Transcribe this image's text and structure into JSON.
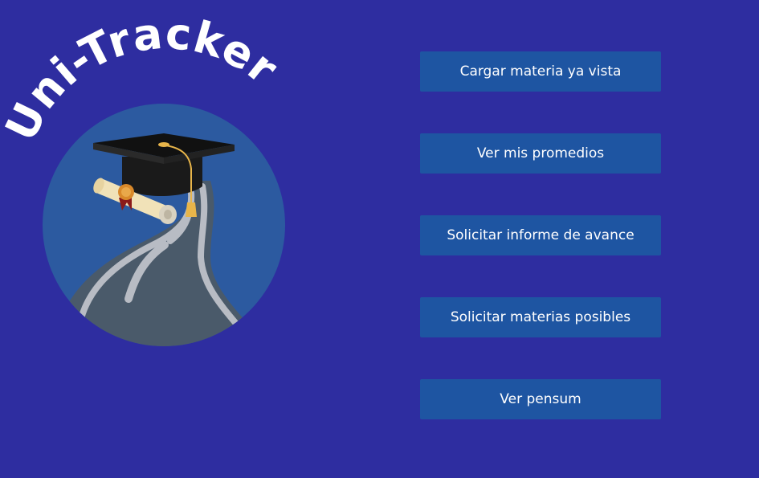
{
  "logo": {
    "title": "Uni-Tracker",
    "icon": "graduation-cap-road-icon"
  },
  "menu": {
    "items": [
      {
        "label": "Cargar materia ya vista"
      },
      {
        "label": "Ver mis promedios"
      },
      {
        "label": "Solicitar informe de avance"
      },
      {
        "label": "Solicitar materias posibles"
      },
      {
        "label": "Ver pensum"
      }
    ]
  },
  "colors": {
    "background": "#2E2DA0",
    "button": "#1E55A2",
    "button_text": "#FFFFFF",
    "circle": "#2C5AA0",
    "road": "#4A5A6A",
    "road_line": "#B8BCC4"
  }
}
